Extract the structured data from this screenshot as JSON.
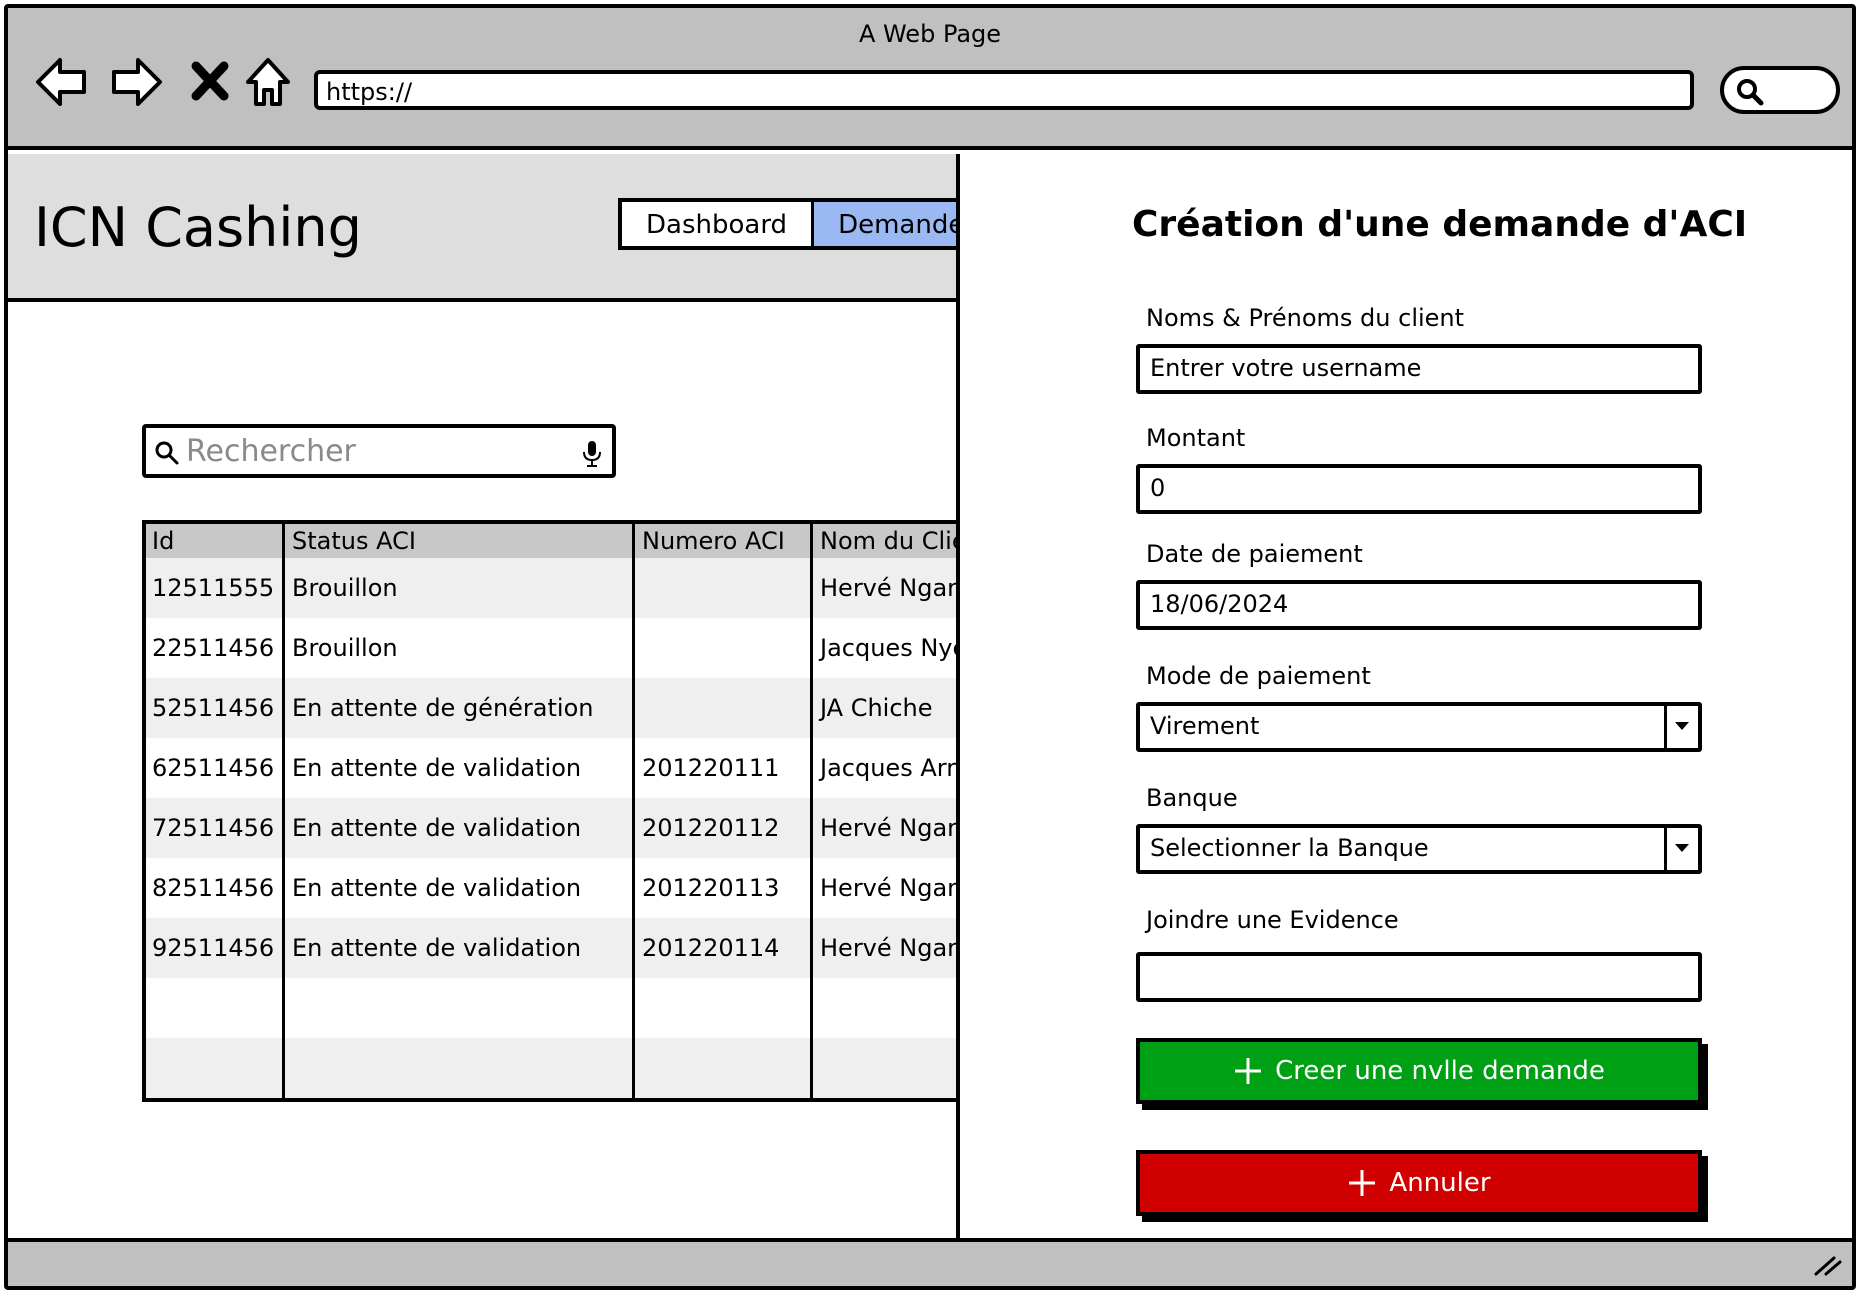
{
  "window": {
    "title": "A Web Page",
    "url": "https://"
  },
  "app": {
    "title": "ICN Cashing"
  },
  "tabs": [
    {
      "label": "Dashboard",
      "active": false
    },
    {
      "label": "Demandes",
      "active": true
    }
  ],
  "search": {
    "placeholder": "Rechercher"
  },
  "table": {
    "columns": [
      "Id",
      "Status ACI",
      "Numero ACI",
      "Nom du Client"
    ],
    "rows": [
      [
        "12511555",
        "Brouillon",
        "",
        "Hervé Ngando"
      ],
      [
        "22511456",
        "Brouillon",
        "",
        "Jacques Nyemb"
      ],
      [
        "52511456",
        "En attente de génération",
        "",
        "JA Chiche"
      ],
      [
        "62511456",
        "En attente de validation",
        "201220111",
        "Jacques Arno"
      ],
      [
        "72511456",
        "En attente de validation",
        "201220112",
        "Hervé Ngando"
      ],
      [
        "82511456",
        "En attente de validation",
        "201220113",
        "Hervé Ngando"
      ],
      [
        "92511456",
        "En attente de validation",
        "201220114",
        "Hervé Ngando"
      ],
      [
        "",
        "",
        "",
        ""
      ],
      [
        "",
        "",
        "",
        ""
      ]
    ]
  },
  "form": {
    "title": "Création  d'une demande d'ACI",
    "client_label": "Noms & Prénoms du client",
    "client_value": "Entrer votre username",
    "amount_label": "Montant",
    "amount_value": "0",
    "date_label": "Date de paiement",
    "date_value": "18/06/2024",
    "mode_label": "Mode de paiement",
    "mode_value": "Virement",
    "bank_label": "Banque",
    "bank_value": "Selectionner la Banque",
    "evidence_label": "Joindre une Evidence",
    "evidence_value": "",
    "create_label": "Creer une nvlle demande",
    "cancel_label": "Annuler"
  },
  "colors": {
    "active_tab": "#9ab8f2",
    "create": "#00a014",
    "cancel": "#d10000",
    "chrome": "#c0c0c0",
    "header": "#dedede"
  }
}
